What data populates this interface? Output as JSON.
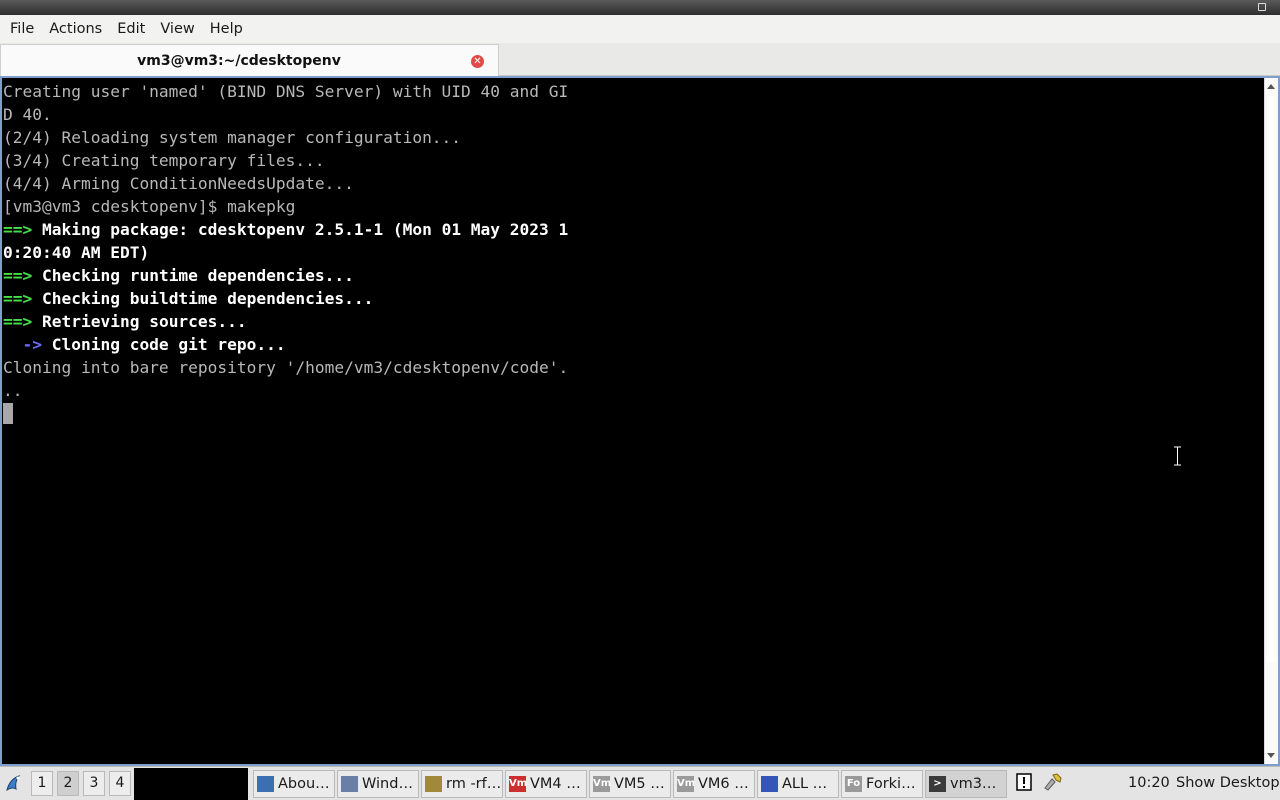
{
  "menubar": {
    "items": [
      "File",
      "Actions",
      "Edit",
      "View",
      "Help"
    ]
  },
  "tab": {
    "title": "vm3@vm3:~/cdesktopenv",
    "close_icon": "close-icon"
  },
  "terminal": {
    "lines": [
      {
        "type": "plain",
        "text": "Creating user 'named' (BIND DNS Server) with UID 40 and GI"
      },
      {
        "type": "plain",
        "text": "D 40."
      },
      {
        "type": "plain",
        "text": "(2/4) Reloading system manager configuration..."
      },
      {
        "type": "plain",
        "text": "(3/4) Creating temporary files..."
      },
      {
        "type": "plain",
        "text": "(4/4) Arming ConditionNeedsUpdate..."
      },
      {
        "type": "plain",
        "text": "[vm3@vm3 cdesktopenv]$ makepkg"
      },
      {
        "type": "green",
        "arrow": "==>",
        "text": " Making package: cdesktopenv 2.5.1-1 (Mon 01 May 2023 1"
      },
      {
        "type": "boldonly",
        "text": "0:20:40 AM EDT)"
      },
      {
        "type": "green",
        "arrow": "==>",
        "text": " Checking runtime dependencies..."
      },
      {
        "type": "green",
        "arrow": "==>",
        "text": " Checking buildtime dependencies..."
      },
      {
        "type": "green",
        "arrow": "==>",
        "text": " Retrieving sources..."
      },
      {
        "type": "blue",
        "arrow": "  ->",
        "text": " Cloning code git repo..."
      },
      {
        "type": "plain",
        "text": "Cloning into bare repository '/home/vm3/cdesktopenv/code'."
      },
      {
        "type": "plain",
        "text": ".."
      }
    ]
  },
  "taskbar": {
    "workspaces": [
      "1",
      "2",
      "3",
      "4"
    ],
    "active_workspace": "2",
    "tasks": [
      {
        "label": "Abou…",
        "icon": "bird-icon",
        "color": "#3a6fb0"
      },
      {
        "label": "Wind…",
        "icon": "window-icon",
        "color": "#6a7fa6"
      },
      {
        "label": "rm -rf…",
        "icon": "tool-icon",
        "color": "#a08a3a"
      },
      {
        "label": "VM4 …",
        "icon": "vm-icon",
        "color": "#cc2f2f",
        "badge": "Vm"
      },
      {
        "label": "VM5 …",
        "icon": "vm-icon",
        "color": "#9a9a9a",
        "badge": "Vm"
      },
      {
        "label": "VM6 …",
        "icon": "vm-icon",
        "color": "#9a9a9a",
        "badge": "Vm"
      },
      {
        "label": "ALL …",
        "icon": "network-icon",
        "color": "#3556b8"
      },
      {
        "label": "Forki…",
        "icon": "fo-icon",
        "color": "#9a9a9a",
        "badge": "Fo"
      },
      {
        "label": "vm3…",
        "icon": "terminal-icon",
        "color": "#3b3b3b",
        "active": true
      }
    ],
    "clock": "10:20",
    "show_desktop": "Show Desktop"
  }
}
